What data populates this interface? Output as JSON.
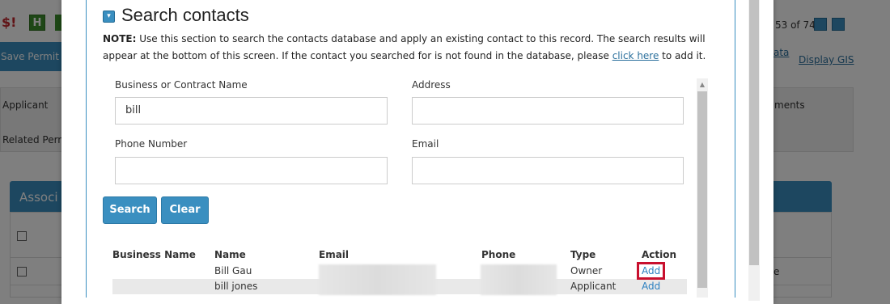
{
  "background": {
    "save_permit": "Save Permit",
    "pager": "53 of 74",
    "link_ata": "ata",
    "link_display_gis": "Display GIS",
    "tab_applicant": "Applicant",
    "tab_related": "Related Perm",
    "tab_attachments": "ments",
    "panel_title": "Associ",
    "row_tail": "e"
  },
  "modal": {
    "title": "Search contacts",
    "note_label": "NOTE:",
    "note_text_1": " Use this section to search the contacts database and apply an existing contact to this record. The search results will appear at the bottom of this screen. If the contact you searched for is not found in the database, please ",
    "note_link": "click here",
    "note_text_2": " to add it."
  },
  "form": {
    "business_label": "Business or Contract Name",
    "business_value": "bill",
    "address_label": "Address",
    "address_value": "",
    "phone_label": "Phone Number",
    "phone_value": "",
    "email_label": "Email",
    "email_value": "",
    "search_button": "Search",
    "clear_button": "Clear"
  },
  "results": {
    "headers": [
      "Business Name",
      "Name",
      "Email",
      "Phone",
      "Type",
      "Action"
    ],
    "rows": [
      {
        "business": "",
        "name": "Bill Gau",
        "type": "Owner",
        "action": "Add"
      },
      {
        "business": "",
        "name": "bill jones",
        "type": "Applicant",
        "action": "Add"
      }
    ]
  },
  "colors": {
    "accent": "#3a8fc0",
    "highlight": "#c8102e",
    "link": "#2a6f9c"
  }
}
